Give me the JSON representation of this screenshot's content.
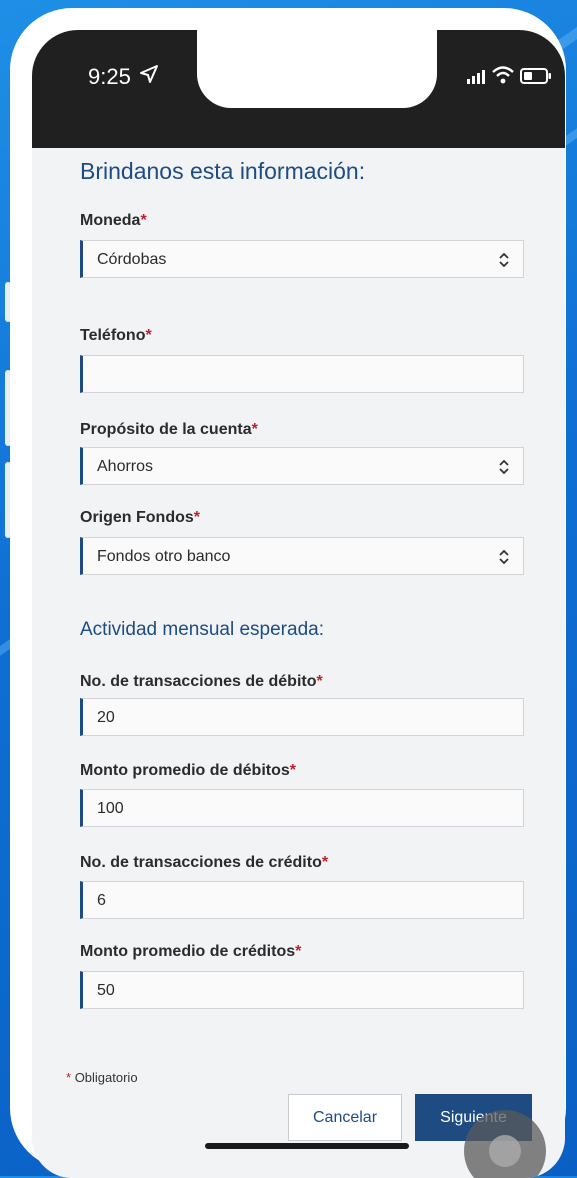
{
  "status": {
    "time": "9:25"
  },
  "form": {
    "title": "Brindanos esta información:",
    "required_mark": "*",
    "moneda": {
      "label": "Moneda",
      "value": "Córdobas"
    },
    "telefono": {
      "label": "Teléfono",
      "value": ""
    },
    "proposito": {
      "label": "Propósito de la cuenta",
      "value": "Ahorros"
    },
    "origen": {
      "label": "Origen Fondos",
      "value": "Fondos otro banco"
    },
    "activity_title": "Actividad mensual esperada:",
    "debit_tx": {
      "label": "No. de transacciones de débito",
      "value": "20"
    },
    "debit_avg": {
      "label": "Monto promedio de débitos",
      "value": "100"
    },
    "credit_tx": {
      "label": "No. de transacciones de crédito",
      "value": "6"
    },
    "credit_avg": {
      "label": "Monto promedio de créditos",
      "value": "50"
    },
    "required_note": "Obligatorio"
  },
  "buttons": {
    "cancel": "Cancelar",
    "next": "Siguiente"
  },
  "icons": {
    "location": "location-arrow-icon",
    "signal": "cellular-signal-icon",
    "wifi": "wifi-icon",
    "battery": "battery-icon",
    "select": "select-chevron-icon"
  },
  "colors": {
    "background": "#0f6fd4",
    "accent": "#1e4c82",
    "required": "#c0202a"
  }
}
